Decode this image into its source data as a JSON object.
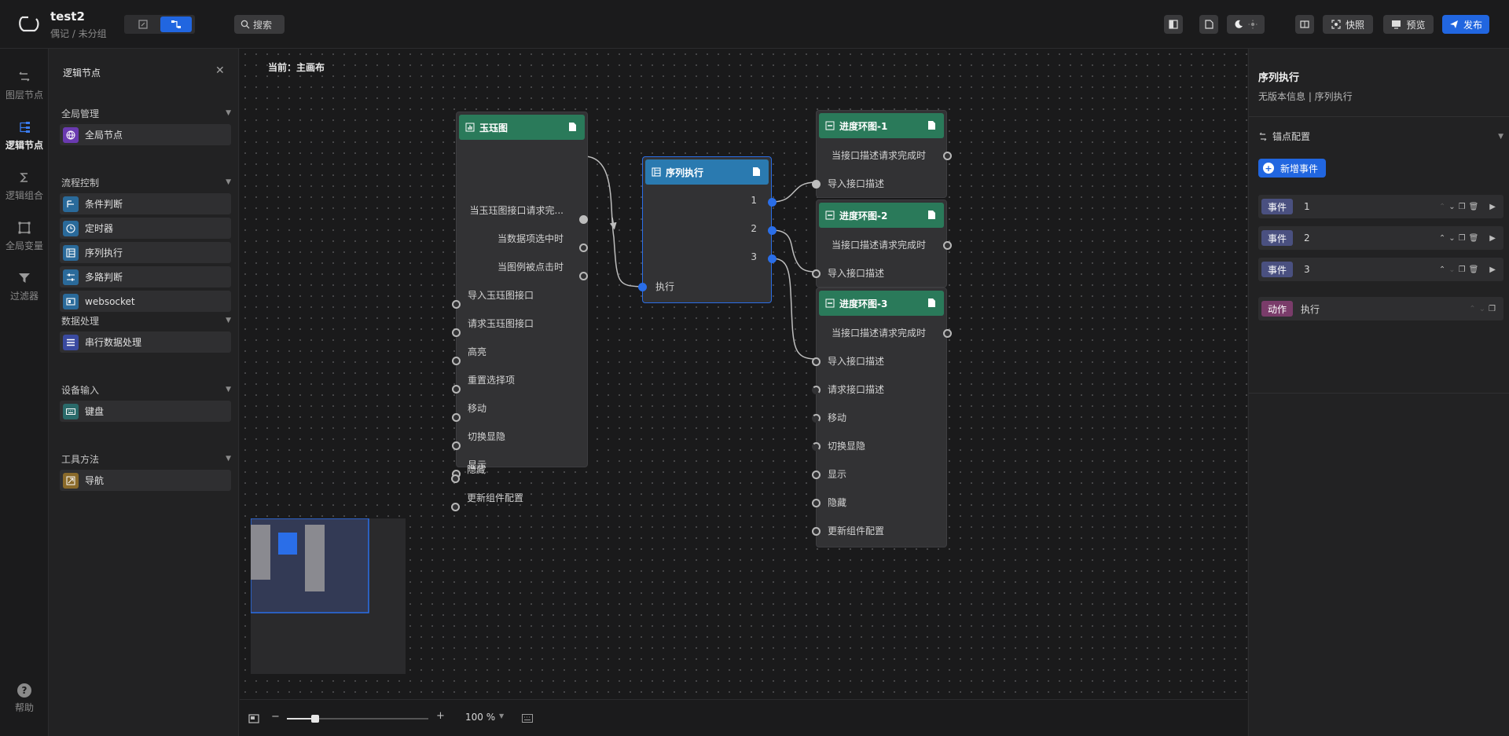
{
  "header": {
    "project_name": "test2",
    "project_path": "偶记 / 未分组",
    "search_label": "搜索",
    "snapshot_label": "快照",
    "preview_label": "预览",
    "publish_label": "发布"
  },
  "rail": {
    "items": [
      {
        "label": "图层节点"
      },
      {
        "label": "逻辑节点"
      },
      {
        "label": "逻辑组合"
      },
      {
        "label": "全局变量"
      },
      {
        "label": "过滤器"
      }
    ],
    "help_label": "帮助"
  },
  "library": {
    "title": "逻辑节点",
    "groups": [
      {
        "title": "全局管理",
        "items": [
          "全局节点"
        ]
      },
      {
        "title": "流程控制",
        "items": [
          "条件判断",
          "定时器",
          "序列执行",
          "多路判断",
          "websocket"
        ]
      },
      {
        "title": "数据处理",
        "items": [
          "串行数据处理"
        ]
      },
      {
        "title": "设备输入",
        "items": [
          "键盘"
        ]
      },
      {
        "title": "工具方法",
        "items": [
          "导航"
        ]
      }
    ]
  },
  "canvas": {
    "breadcrumb": "当前：主画布",
    "nodes": {
      "ring_chart": {
        "title": "玉珏图",
        "ports": [
          "当玉珏图接口请求完...",
          "当数据项选中时",
          "当图例被点击时",
          "导入玉珏图接口",
          "请求玉珏图接口",
          "高亮",
          "重置选择项",
          "移动",
          "切换显隐",
          "显示",
          "隐藏",
          "更新组件配置"
        ]
      },
      "sequence": {
        "title": "序列执行",
        "ports": [
          "1",
          "2",
          "3",
          "执行"
        ]
      },
      "progress1": {
        "title": "进度环图-1",
        "ports": [
          "当接口描述请求完成时",
          "导入接口描述"
        ]
      },
      "progress2": {
        "title": "进度环图-2",
        "ports": [
          "当接口描述请求完成时",
          "导入接口描述"
        ]
      },
      "progress3": {
        "title": "进度环图-3",
        "ports": [
          "当接口描述请求完成时",
          "导入接口描述",
          "请求接口描述",
          "移动",
          "切换显隐",
          "显示",
          "隐藏",
          "更新组件配置"
        ]
      }
    }
  },
  "zoom": {
    "value_label": "100 %",
    "minus": "−",
    "plus": "+",
    "slider_fraction": 0.2
  },
  "inspector": {
    "title": "序列执行",
    "subtitle": "无版本信息 | 序列执行",
    "section_title": "锚点配置",
    "add_event_label": "新增事件",
    "events": [
      {
        "tag": "事件",
        "value": "1"
      },
      {
        "tag": "事件",
        "value": "2"
      },
      {
        "tag": "事件",
        "value": "3"
      }
    ],
    "action": {
      "tag": "动作",
      "value": "执行"
    }
  },
  "colors": {
    "accent": "#2166e0",
    "node_head_green": "#2a7a5a",
    "node_head_blue": "#2a7ab0",
    "port_blue": "#2a6ee8"
  }
}
